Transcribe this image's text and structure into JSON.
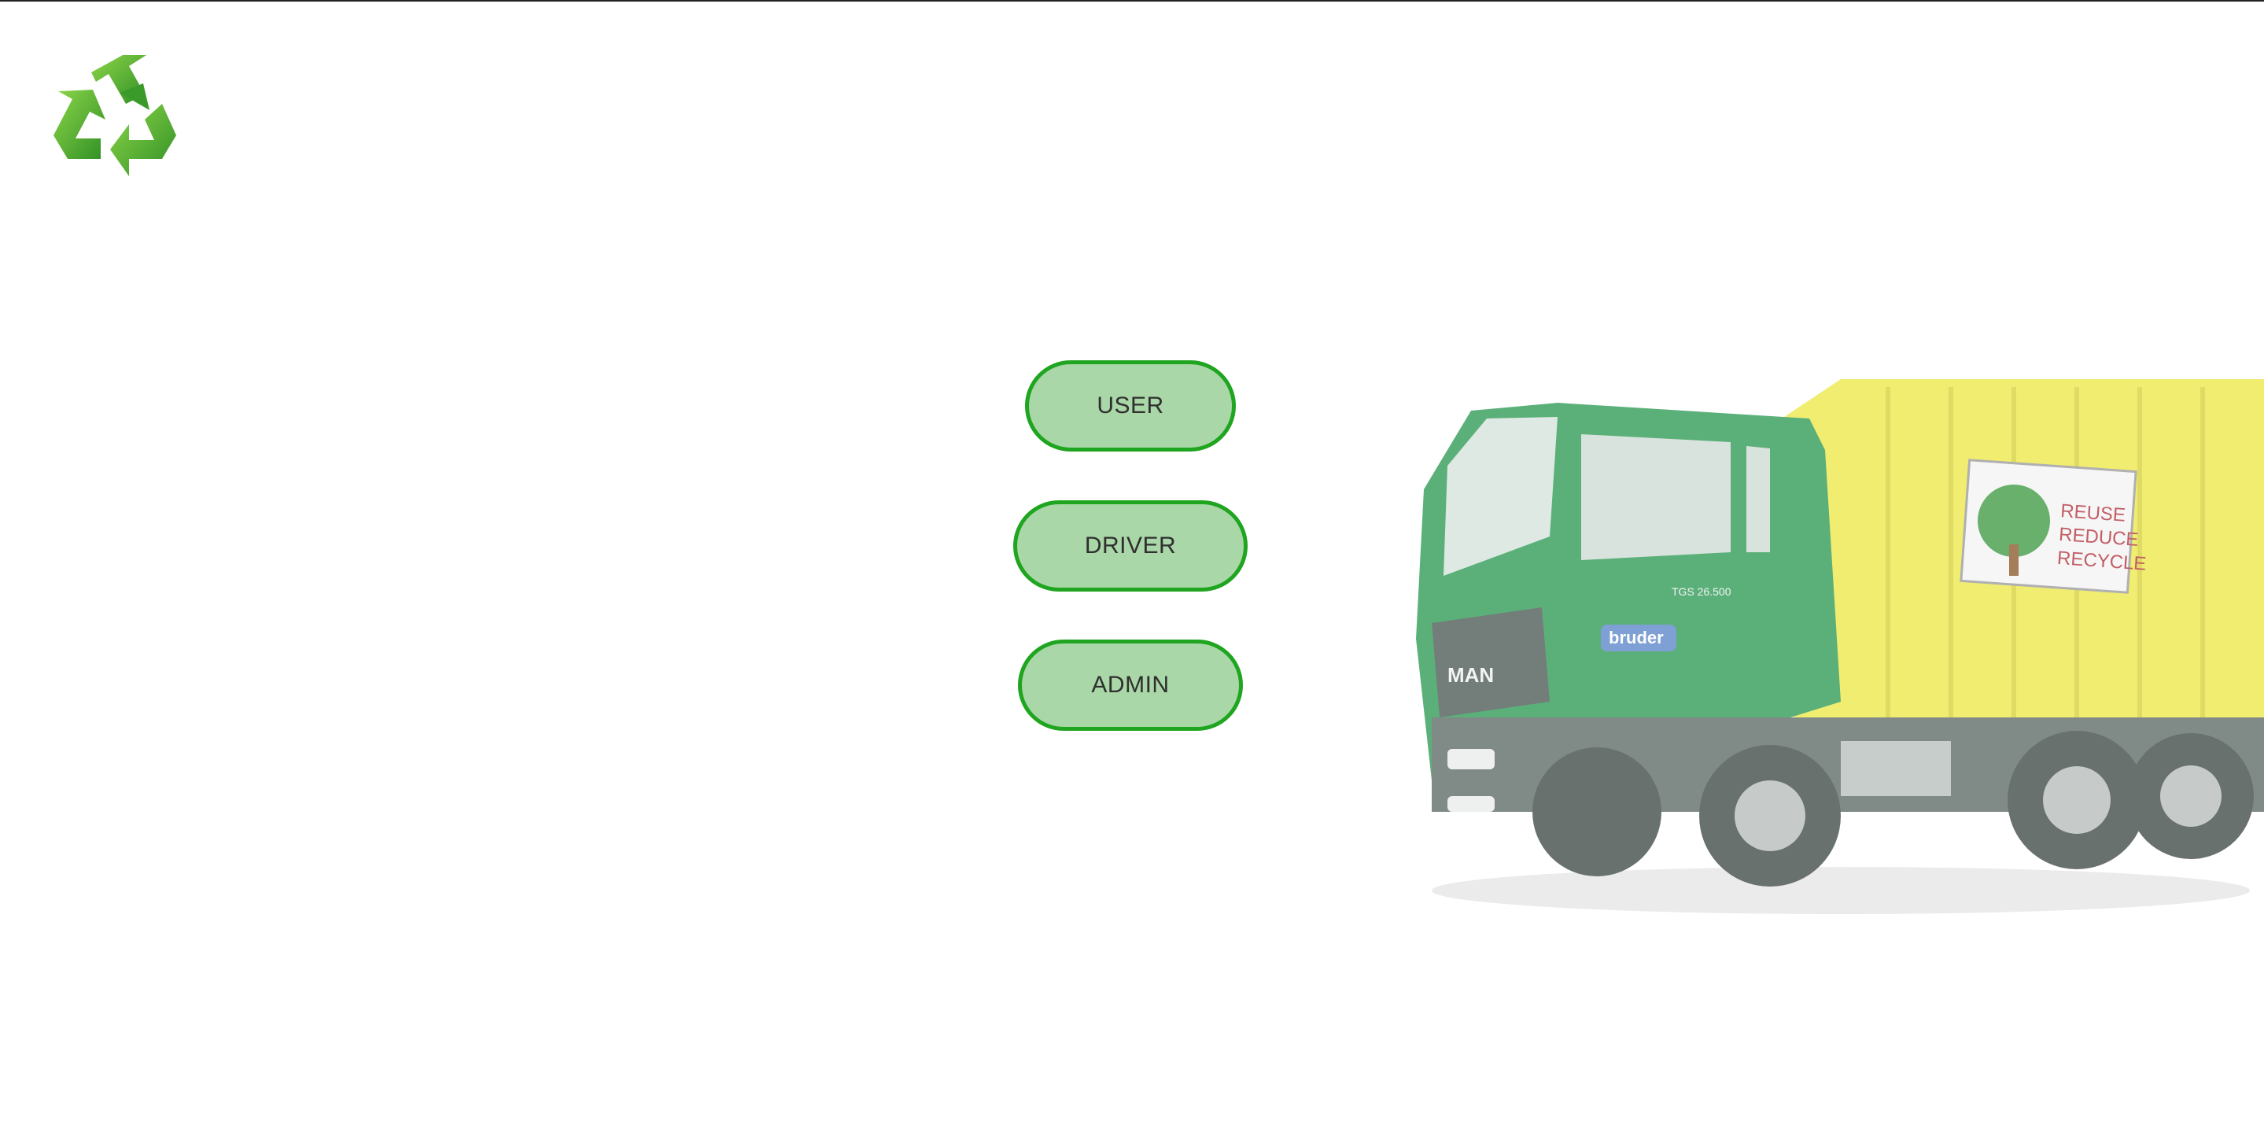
{
  "logo": {
    "icon": "recycle-icon",
    "color": "#43a62f"
  },
  "roles": {
    "user_label": "USER",
    "driver_label": "DRIVER",
    "admin_label": "ADMIN"
  },
  "colors": {
    "button_fill": "#a9d7a7",
    "button_border": "#1fa51f",
    "truck_cab": "#2e9a55",
    "truck_body": "#ede84a"
  },
  "truck": {
    "sign_lines": [
      "REUSE",
      "REDUCE",
      "RECYCLE"
    ],
    "brand": "bruder",
    "cab_brand": "MAN",
    "model": "TGS 26.500"
  }
}
